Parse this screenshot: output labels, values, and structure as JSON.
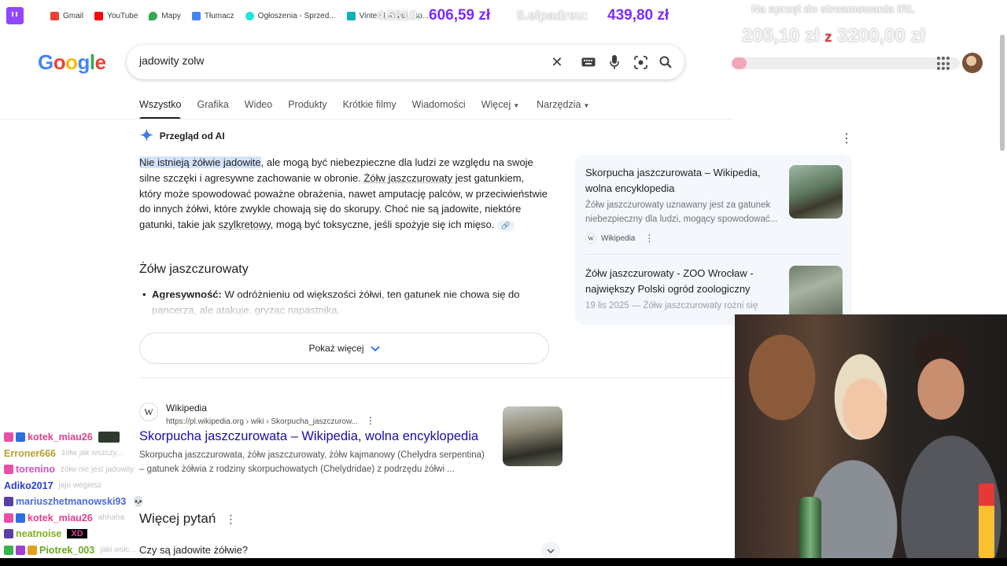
{
  "bookmarks": [
    {
      "label": "Gmail",
      "icon": "gmail-icon",
      "color": "#ea4335"
    },
    {
      "label": "YouTube",
      "icon": "youtube-icon",
      "color": "#ff0000"
    },
    {
      "label": "Mapy",
      "icon": "maps-icon",
      "color": "#34a853"
    },
    {
      "label": "Tłumacz",
      "icon": "translate-icon",
      "color": "#4285f4"
    },
    {
      "label": "Ogłoszenia - Sprzed...",
      "icon": "olx-icon",
      "color": "#23e5db"
    },
    {
      "label": "Vinted | Kupuj i sp...",
      "icon": "vinted-icon",
      "color": "#09b1ba"
    }
  ],
  "overlay": {
    "rank_label_faded": "4.5810:",
    "amount1": "606,59 zł",
    "donor2": "5.elpadreu:",
    "amount2": "439,80 zł",
    "goal_title": "Na sprzęt do streamowania IRL",
    "goal_current": "205,10 zł",
    "goal_sep": "z",
    "goal_target": "3200,00 zł",
    "goal_progress": 0.064
  },
  "search": {
    "logo": "Google",
    "query": "jadowity zolw"
  },
  "tabs": [
    {
      "label": "Wszystko",
      "active": true
    },
    {
      "label": "Grafika"
    },
    {
      "label": "Wideo"
    },
    {
      "label": "Produkty"
    },
    {
      "label": "Krótkie filmy"
    },
    {
      "label": "Wiadomości"
    },
    {
      "label": "Więcej",
      "dropdown": true
    },
    {
      "label": "Narzędzia",
      "dropdown": true
    }
  ],
  "ai": {
    "header": "Przegląd od AI",
    "p_highlight": "Nie istnieją żółwie jadowite",
    "p1": ", ale mogą być niebezpieczne dla ludzi ze względu na swoje silne szczęki i agresywne zachowanie w obronie. ",
    "p_link1": "Żółw jaszczurowaty",
    "p2": " jest gatunkiem, który może spowodować poważne obrażenia, nawet amputację palców, w przeciwieństwie do innych żółwi, które zwykle chowają się do skorupy. Choć nie są jadowite, niektóre gatunki, takie jak ",
    "p_link2": "szylkretowy",
    "p3": ", mogą być toksyczne, jeśli spożyje się ich mięso.",
    "subhead": "Żółw jaszczurowaty",
    "bullet_bold": "Agresywność:",
    "bullet_text": " W odróżnieniu od większości żółwi, ten gatunek nie chowa się do pancerza, ale atakuje, gryząc napastnika.",
    "show_more": "Pokaż więcej"
  },
  "sources": [
    {
      "title": "Skorpucha jaszczurowata – Wikipedia, wolna encyklopedia",
      "snippet": "Żółw jaszczurowaty uznawany jest za gatunek niebezpieczny dla ludzi, mogący spowodować...",
      "site": "Wikipedia"
    },
    {
      "title": "Żółw jaszczurowaty - ZOO Wrocław - największy Polski ogród zoologiczny",
      "snippet": "19 lis 2025 — Żółw jaszczurowaty rożni się"
    }
  ],
  "result": {
    "site_name": "Wikipedia",
    "url": "https://pl.wikipedia.org › wiki › Skorpucha_jaszczurow...",
    "title": "Skorpucha jaszczurowata – Wikipedia, wolna encyklopedia",
    "snippet": "Skorpucha jaszczurowata, żółw jaszczurowaty, żółw kajmanowy (Chelydra serpentina) – gatunek żółwia z rodziny skorpuchowatych (Chelydridae) z podrzędu żółwi ..."
  },
  "paa": {
    "title": "Więcej pytań",
    "question": "Czy są jadowite żółwie?"
  },
  "chat": [
    {
      "user": "kotek_miau26",
      "color": "#e0408f",
      "badges": [
        "#e94fa6",
        "#2b6fe0"
      ],
      "emote": "#2f3a2f"
    },
    {
      "user": "Erroner666",
      "color": "#b8a032",
      "badges": [],
      "msg": "żółw jak wszczy..."
    },
    {
      "user": "torenino",
      "color": "#d04fc0",
      "badges": [
        "#e94fa6"
      ],
      "msg": "żółw nie jest jadowity"
    },
    {
      "user": "Adiko2017",
      "color": "#2b3fd0",
      "badges": [],
      "msg": "jajo wegiesz"
    },
    {
      "user": "mariuszhetmanowski93",
      "color": "#4a6ad8",
      "badges": [
        "#5b3fa8"
      ],
      "emote_glyph": "💀"
    },
    {
      "user": "kotek_miau26",
      "color": "#e0408f",
      "badges": [
        "#e94fa6",
        "#2b6fe0"
      ],
      "msg": "ahhaha"
    },
    {
      "user": "neatnoise",
      "color": "#7fb020",
      "badges": [
        "#5b3fa8"
      ],
      "emote_text": "XD"
    },
    {
      "user": "Piotrek_003",
      "color": "#6aa81e",
      "badges": [
        "#3ab34a",
        "#a33fd0",
        "#e0a020"
      ],
      "msg": "jaki wsłc..."
    }
  ],
  "colors": {
    "link_blue": "#1a0dab",
    "twitch_purple": "#9146ff",
    "highlight": "#d3e3fd"
  }
}
